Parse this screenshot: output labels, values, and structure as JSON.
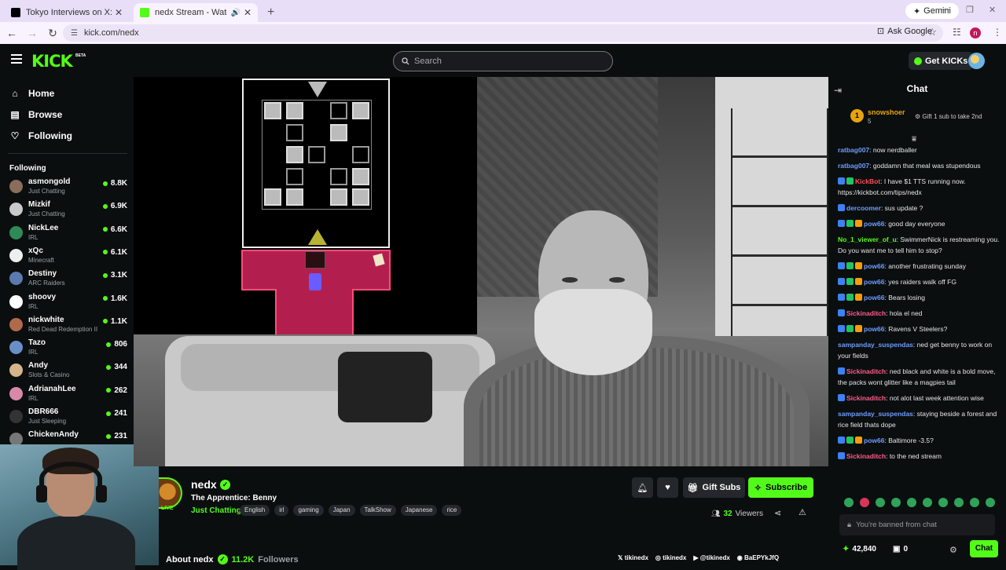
{
  "browser": {
    "tabs": [
      {
        "title": "Tokyo Interviews on X: \"@calligirl...",
        "favicon_color": "#000000"
      },
      {
        "title": "nedx Stream - Watch Live o",
        "favicon_color": "#53fc18"
      }
    ],
    "gemini_label": "Gemini",
    "url": "kick.com/nedx",
    "ask_google": "Ask Google",
    "profile_initial": "n"
  },
  "header": {
    "logo": "KICK",
    "beta": "BETA",
    "search_placeholder": "Search",
    "get_kicks": "Get KICKs"
  },
  "sidebar": {
    "nav": [
      {
        "label": "Home",
        "icon": "home-icon"
      },
      {
        "label": "Browse",
        "icon": "browse-icon"
      },
      {
        "label": "Following",
        "icon": "heart-icon"
      }
    ],
    "following_header": "Following",
    "following": [
      {
        "name": "asmongold",
        "category": "Just Chatting",
        "viewers": "8.8K",
        "color": "#8a6d5a"
      },
      {
        "name": "Mizkif",
        "category": "Just Chatting",
        "viewers": "6.9K",
        "color": "#c9c9c9"
      },
      {
        "name": "NickLee",
        "category": "IRL",
        "viewers": "6.6K",
        "color": "#2e8b57"
      },
      {
        "name": "xQc",
        "category": "Minecraft",
        "viewers": "6.1K",
        "color": "#eeeeee"
      },
      {
        "name": "Destiny",
        "category": "ARC Raiders",
        "viewers": "3.1K",
        "color": "#5a7ab0"
      },
      {
        "name": "shoovy",
        "category": "IRL",
        "viewers": "1.6K",
        "color": "#ffffff"
      },
      {
        "name": "nickwhite",
        "category": "Red Dead Redemption II",
        "viewers": "1.1K",
        "color": "#b06a4a"
      },
      {
        "name": "Tazo",
        "category": "IRL",
        "viewers": "806",
        "color": "#6a8ec8"
      },
      {
        "name": "Andy",
        "category": "Slots & Casino",
        "viewers": "344",
        "color": "#d6b48a"
      },
      {
        "name": "AdrianahLee",
        "category": "IRL",
        "viewers": "262",
        "color": "#d889a8"
      },
      {
        "name": "DBR666",
        "category": "Just Sleeping",
        "viewers": "241",
        "color": "#333333"
      },
      {
        "name": "ChickenAndy",
        "category": "",
        "viewers": "231",
        "color": "#777777"
      }
    ]
  },
  "stream": {
    "live_badge": "LIVE",
    "channel": "nedx",
    "title": "The Apprentice: Benny",
    "category": "Just Chatting",
    "tags": [
      "English",
      "irl",
      "gaming",
      "Japan",
      "TalkShow",
      "Japanese",
      "rice"
    ],
    "gift_subs": "Gift Subs",
    "subscribe": "Subscribe",
    "viewer_count": "32",
    "viewers_label": "Viewers",
    "about": "About nedx",
    "followers_count": "11.2K",
    "followers_label": "Followers",
    "socials": [
      {
        "icon": "x-icon",
        "handle": "tikinedx"
      },
      {
        "icon": "instagram-icon",
        "handle": "tikinedx"
      },
      {
        "icon": "youtube-icon",
        "handle": "@tikinedx"
      },
      {
        "icon": "discord-icon",
        "handle": "BaEPYkJfQ"
      }
    ]
  },
  "chat": {
    "title": "Chat",
    "pinned": {
      "rank": "1",
      "name": "snowshoer",
      "count": "5",
      "gift_text": "Gift 1 sub to take 2nd"
    },
    "messages": [
      {
        "user": "ratbag007",
        "color": "#6e9cff",
        "text": "now nerdballer",
        "badges": 0
      },
      {
        "user": "ratbag007",
        "color": "#6e9cff",
        "text": "goddamn that meal was stupendous",
        "badges": 0
      },
      {
        "user": "KickBot",
        "color": "#ff4d5a",
        "text": "I have $1 TTS running now. https://kickbot.com/tips/nedx",
        "badges": 2
      },
      {
        "user": "dercoomer",
        "color": "#6e9cff",
        "text": "sus update ?",
        "badges": 1
      },
      {
        "user": "pow66",
        "color": "#6e9cff",
        "text": "good day everyone",
        "badges": 3
      },
      {
        "user": "No_1_viewer_of_u",
        "color": "#53fc18",
        "text": "SwimmerNick is restreaming you. Do you want me to tell him to stop?",
        "badges": 0
      },
      {
        "user": "pow66",
        "color": "#6e9cff",
        "text": "another frustrating sunday",
        "badges": 3
      },
      {
        "user": "pow66",
        "color": "#6e9cff",
        "text": "yes raiders walk off FG",
        "badges": 3
      },
      {
        "user": "pow66",
        "color": "#6e9cff",
        "text": "Bears losing",
        "badges": 3
      },
      {
        "user": "Sickinaditch",
        "color": "#ff5c8a",
        "text": "hola el ned",
        "badges": 1
      },
      {
        "user": "pow66",
        "color": "#6e9cff",
        "text": "Ravens V Steelers?",
        "badges": 3
      },
      {
        "user": "sampanday_suspendas",
        "color": "#6e9cff",
        "text": "ned get benny to work on your fields",
        "badges": 0
      },
      {
        "user": "Sickinaditch",
        "color": "#ff5c8a",
        "text": "ned black and white is a bold move, the packs wont glitter like a magpies tail",
        "badges": 1
      },
      {
        "user": "Sickinaditch",
        "color": "#ff5c8a",
        "text": "not alot last week attention wise",
        "badges": 1
      },
      {
        "user": "sampanday_suspendas",
        "color": "#6e9cff",
        "text": "staying beside a forest and rice field thats dope",
        "badges": 0
      },
      {
        "user": "pow66",
        "color": "#6e9cff",
        "text": "Baltimore -3.5?",
        "badges": 3
      },
      {
        "user": "Sickinaditch",
        "color": "#ff5c8a",
        "text": "to the ned stream",
        "badges": 1
      }
    ],
    "banned_text": "You're banned from chat",
    "kicks_balance": "42,840",
    "sub_balance": "0",
    "chat_button": "Chat"
  },
  "colors": {
    "accent": "#53fc18",
    "background": "#0b0e0f",
    "surface": "#24272c"
  }
}
